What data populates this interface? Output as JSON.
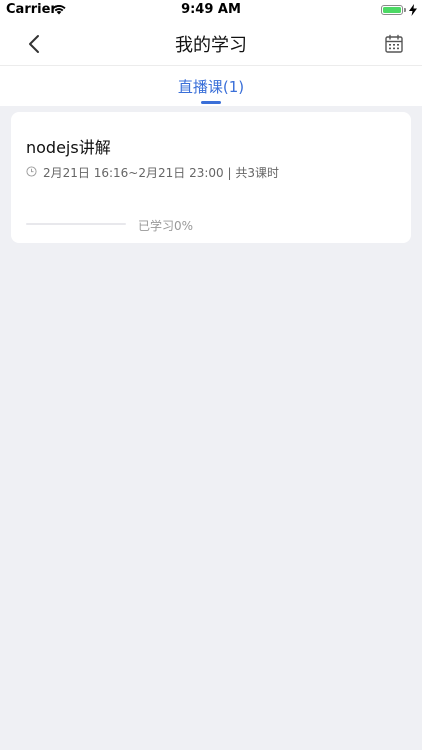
{
  "status_bar": {
    "carrier": "Carrier",
    "time": "9:49 AM",
    "battery_level": 1.0,
    "charging": true
  },
  "header": {
    "title": "我的学习",
    "back_icon": "chevron-left-icon",
    "calendar_icon": "calendar-icon"
  },
  "tabs": [
    {
      "label": "直播课(1)",
      "active": true
    }
  ],
  "courses": [
    {
      "title": "nodejs讲解",
      "schedule": "2月21日 16:16~2月21日 23:00 | 共3课时",
      "progress": 0,
      "progress_label": "已学习0%"
    }
  ],
  "colors": {
    "accent": "#3a6fd8",
    "background": "#eff0f4",
    "card": "#ffffff",
    "battery": "#4cd964"
  }
}
